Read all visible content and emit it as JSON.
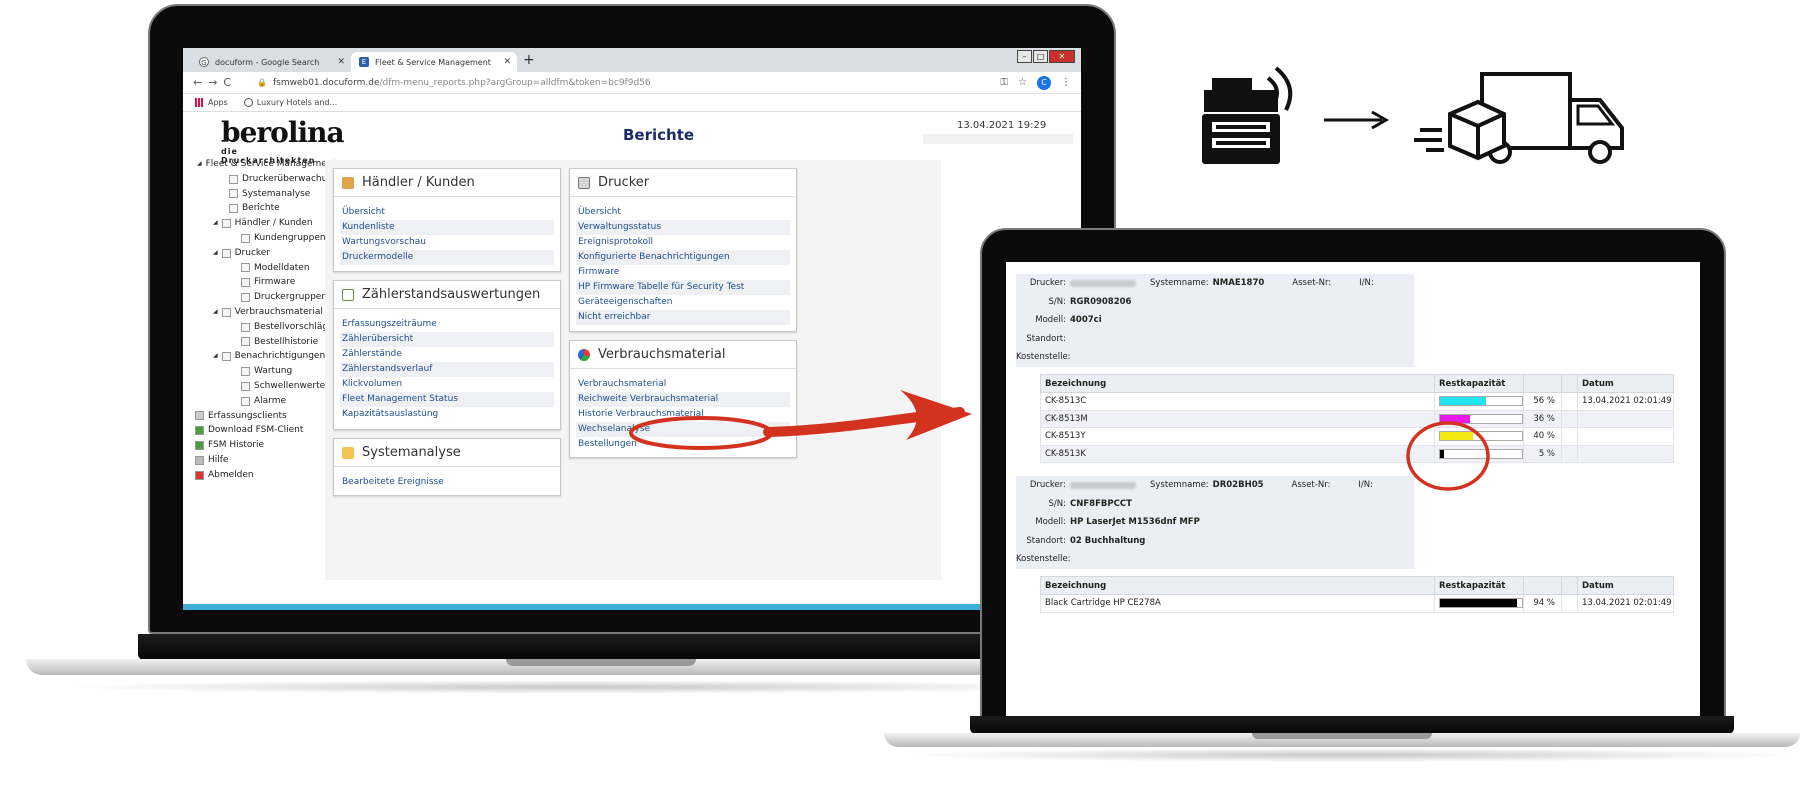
{
  "browser": {
    "tabs": [
      {
        "label": "docuform - Google Search",
        "icon": "google-icon"
      },
      {
        "label": "Fleet & Service Management",
        "icon": "fsm-icon"
      }
    ],
    "new_tab": "+",
    "url_host": "fsmweb01.docuform.de",
    "url_path": "/dfm-menu_reports.php?argGroup=alldfm&token=bc9f9d56",
    "bookmarks": [
      "Apps",
      "Luxury Hotels and..."
    ],
    "avatar_letter": "C"
  },
  "app": {
    "logo_text": "berolina",
    "logo_tagline": "die Druckarchitekten",
    "page_title": "Berichte",
    "datetime": "13.04.2021 19:29"
  },
  "tree": [
    {
      "label": "Fleet & Service Management",
      "level": 0,
      "expand": true
    },
    {
      "label": "Druckerüberwachung",
      "level": 2
    },
    {
      "label": "Systemanalyse",
      "level": 2
    },
    {
      "label": "Berichte",
      "level": 2
    },
    {
      "label": "Händler / Kunden",
      "level": 1,
      "expand": true
    },
    {
      "label": "Kundengruppen",
      "level": 3
    },
    {
      "label": "Drucker",
      "level": 1,
      "expand": true
    },
    {
      "label": "Modelldaten",
      "level": 3
    },
    {
      "label": "Firmware",
      "level": 3
    },
    {
      "label": "Druckergruppen",
      "level": 3
    },
    {
      "label": "Verbrauchsmaterial",
      "level": 1,
      "expand": true
    },
    {
      "label": "Bestellvorschläge",
      "level": 3
    },
    {
      "label": "Bestellhistorie",
      "level": 3
    },
    {
      "label": "Benachrichtigungen",
      "level": 1,
      "expand": true
    },
    {
      "label": "Wartung",
      "level": 3
    },
    {
      "label": "Schwellenwerte",
      "level": 3
    },
    {
      "label": "Alarme",
      "level": 3
    },
    {
      "label": "Erfassungsclients",
      "level": -1
    },
    {
      "label": "Download FSM-Client",
      "level": -1
    },
    {
      "label": "FSM Historie",
      "level": -1
    },
    {
      "label": "Hilfe",
      "level": -1
    },
    {
      "label": "Abmelden",
      "level": -1
    }
  ],
  "boxes": {
    "haendler": {
      "title": "Händler / Kunden",
      "links": [
        "Übersicht",
        "Kundenliste",
        "Wartungsvorschau",
        "Druckermodelle"
      ]
    },
    "zaehler": {
      "title": "Zählerstandsauswertungen",
      "links": [
        "Erfassungszeiträume",
        "Zählerübersicht",
        "Zählerstände",
        "Zählerstandsverlauf",
        "Klickvolumen",
        "Fleet Management Status",
        "Kapazitätsauslastung"
      ]
    },
    "system": {
      "title": "Systemanalyse",
      "links": [
        "Bearbeitete Ereignisse"
      ]
    },
    "drucker": {
      "title": "Drucker",
      "links": [
        "Übersicht",
        "Verwaltungsstatus",
        "Ereignisprotokoll",
        "Konfigurierte Benachrichtigungen",
        "Firmware",
        "HP Firmware Tabelle für Security Test",
        "Geräteeigenschaften",
        "Nicht erreichbar"
      ]
    },
    "verbrauch": {
      "title": "Verbrauchsmaterial",
      "links": [
        "Verbrauchsmaterial",
        "Reichweite Verbrauchsmaterial",
        "Historie Verbrauchsmaterial",
        "Wechselanalyse",
        "Bestellungen"
      ]
    }
  },
  "report": {
    "labels": {
      "drucker": "Drucker:",
      "systemname": "Systemname:",
      "asset": "Asset-Nr:",
      "in": "I/N:",
      "sn": "S/N:",
      "modell": "Modell:",
      "standort": "Standort:",
      "kostenstelle": "Kostenstelle:"
    },
    "columns": {
      "bezeichnung": "Bezeichnung",
      "rest": "Restkapazität",
      "datum": "Datum"
    },
    "devices": [
      {
        "systemname": "NMAE1870",
        "sn": "RGR0908206",
        "modell": "4007ci",
        "standort": "",
        "supplies": [
          {
            "name": "CK-8513C",
            "percent": 56,
            "pct_label": "56 %",
            "color": "#22e3f0",
            "datum": "13.04.2021 02:01:49"
          },
          {
            "name": "CK-8513M",
            "percent": 36,
            "pct_label": "36 %",
            "color": "#e81ae8",
            "datum": ""
          },
          {
            "name": "CK-8513Y",
            "percent": 40,
            "pct_label": "40 %",
            "color": "#f2ea10",
            "datum": ""
          },
          {
            "name": "CK-8513K",
            "percent": 5,
            "pct_label": "5 %",
            "color": "#000000",
            "datum": ""
          }
        ]
      },
      {
        "systemname": "DR02BH05",
        "sn": "CNF8FBPCCT",
        "modell": "HP LaserJet M1536dnf MFP",
        "standort": "02 Buchhaltung",
        "supplies": [
          {
            "name": "Black Cartridge HP CE278A",
            "percent": 94,
            "pct_label": "94 %",
            "color": "#000000",
            "datum": "13.04.2021 02:01:49"
          }
        ]
      }
    ]
  },
  "colors": {
    "accent_red": "#d2321e",
    "link_blue": "#1d4f91",
    "title_navy": "#1a2b6b"
  }
}
